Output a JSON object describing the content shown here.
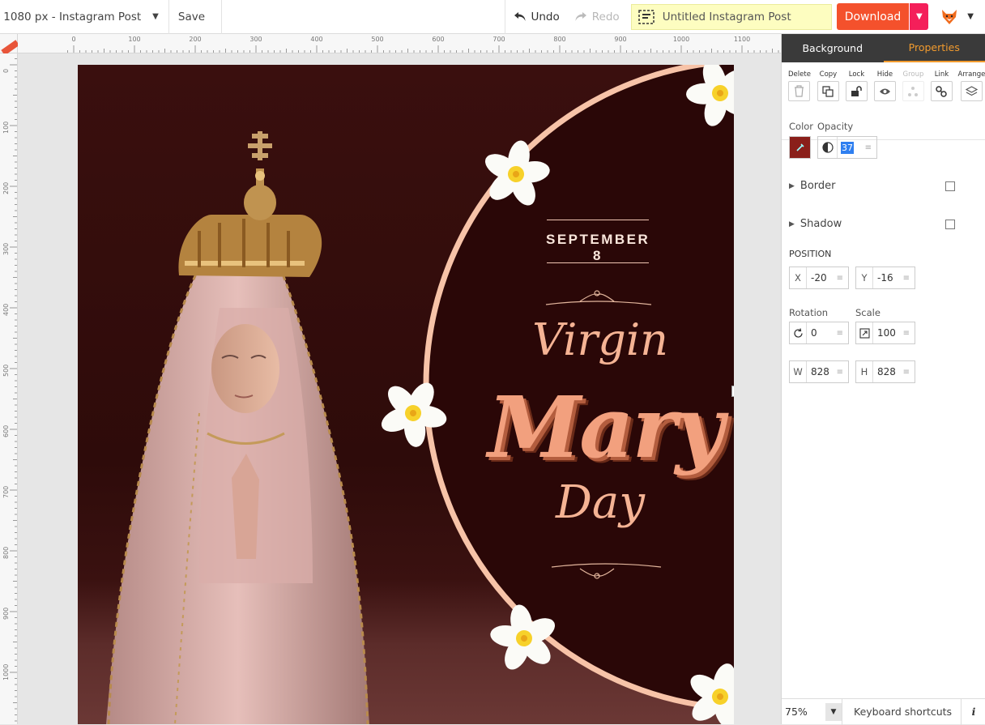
{
  "topbar": {
    "doc_size": "x 1080 px - Instagram Post",
    "save": "Save",
    "undo": "Undo",
    "redo": "Redo",
    "doc_title": "Untitled Instagram Post",
    "download": "Download"
  },
  "ruler": {
    "top_labels": [
      "0",
      "100",
      "200",
      "300",
      "400",
      "500",
      "600",
      "700",
      "800",
      "900",
      "1000",
      "1100"
    ],
    "left_labels": [
      "0",
      "100",
      "200",
      "300",
      "400",
      "500",
      "600",
      "700",
      "800",
      "900",
      "1000"
    ]
  },
  "design": {
    "date": "SEPTEMBER 8",
    "line1": "Virgin",
    "line2": "Mary",
    "line3": "Day",
    "colors": {
      "background": "#2e0b0a",
      "accent": "#f5b394",
      "ring": "#f7c3a8"
    }
  },
  "panel": {
    "tabs": {
      "background": "Background",
      "properties": "Properties"
    },
    "actions": [
      {
        "label": "Delete",
        "icon": "trash-icon"
      },
      {
        "label": "Copy",
        "icon": "copy-icon"
      },
      {
        "label": "Lock",
        "icon": "unlock-icon"
      },
      {
        "label": "Hide",
        "icon": "eye-icon"
      },
      {
        "label": "Group",
        "icon": "group-icon"
      },
      {
        "label": "Link",
        "icon": "link-icon"
      },
      {
        "label": "Arrange",
        "icon": "layers-icon"
      }
    ],
    "color_label": "Color",
    "color_value": "#8a1f1a",
    "opacity_label": "Opacity",
    "opacity": "37",
    "border_label": "Border",
    "shadow_label": "Shadow",
    "position_label": "POSITION",
    "x_label": "X",
    "x": "-20",
    "y_label": "Y",
    "y": "-16",
    "rotation_label": "Rotation",
    "rotation": "0",
    "scale_label": "Scale",
    "scale": "100",
    "w_label": "W",
    "w": "828",
    "h_label": "H",
    "h": "828",
    "zoom": "75%",
    "shortcuts": "Keyboard shortcuts",
    "info": "i"
  }
}
